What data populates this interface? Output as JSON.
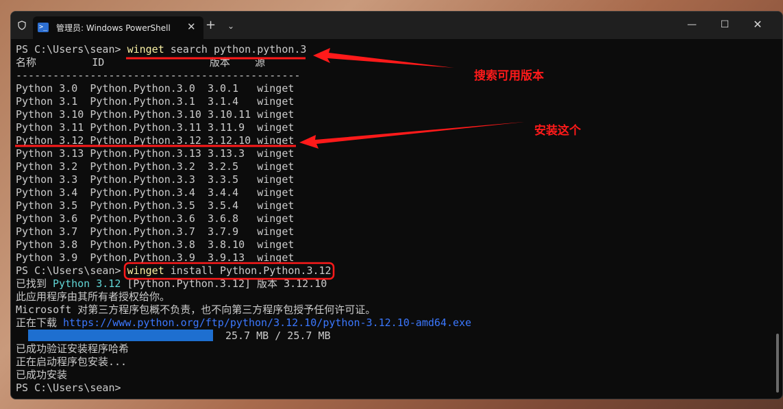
{
  "window": {
    "tab_title": "管理员: Windows PowerShell",
    "tab_icon": "powershell-icon",
    "close_glyph": "✕",
    "new_tab_glyph": "+",
    "dropdown_glyph": "⌄",
    "min_glyph": "—",
    "max_glyph": "☐",
    "win_close_glyph": "✕"
  },
  "terminal": {
    "prompt": "PS C:\\Users\\sean> ",
    "cmd1_exe": "winget",
    "cmd1_args": " search python.python.3",
    "header_line": "名称         ID                 版本    源",
    "separator": "----------------------------------------------",
    "rows": [
      "Python 3.0  Python.Python.3.0  3.0.1   winget",
      "Python 3.1  Python.Python.3.1  3.1.4   winget",
      "Python 3.10 Python.Python.3.10 3.10.11 winget",
      "Python 3.11 Python.Python.3.11 3.11.9  winget",
      "Python 3.12 Python.Python.3.12 3.12.10 winget",
      "Python 3.13 Python.Python.3.13 3.13.3  winget",
      "Python 3.2  Python.Python.3.2  3.2.5   winget",
      "Python 3.3  Python.Python.3.3  3.3.5   winget",
      "Python 3.4  Python.Python.3.4  3.4.4   winget",
      "Python 3.5  Python.Python.3.5  3.5.4   winget",
      "Python 3.6  Python.Python.3.6  3.6.8   winget",
      "Python 3.7  Python.Python.3.7  3.7.9   winget",
      "Python 3.8  Python.Python.3.8  3.8.10  winget",
      "Python 3.9  Python.Python.3.9  3.9.13  winget"
    ],
    "cmd2_exe": "winget",
    "cmd2_args": " install Python.Python.3.12",
    "found_prefix": "已找到 ",
    "found_name": "Python 3.12",
    "found_id": " [Python.Python.3.12]",
    "found_suffix": " 版本 3.12.10",
    "license_line": "此应用程序由其所有者授权给你。",
    "ms_line": "Microsoft 对第三方程序包概不负责，也不向第三方程序包授予任何许可证。",
    "downloading_prefix": "正在下载 ",
    "download_url": "https://www.python.org/ftp/python/3.12.10/python-3.12.10-amd64.exe",
    "progress_text": "25.7 MB / 25.7 MB",
    "progress_fraction": 1.0,
    "verified_line": "已成功验证安装程序哈希",
    "starting_line": "正在启动程序包安装...",
    "installed_line": "已成功安装",
    "final_prompt": "PS C:\\Users\\sean>"
  },
  "annotations": {
    "search_label": "搜索可用版本",
    "install_label": "安装这个",
    "color": "#ff1a1a"
  }
}
